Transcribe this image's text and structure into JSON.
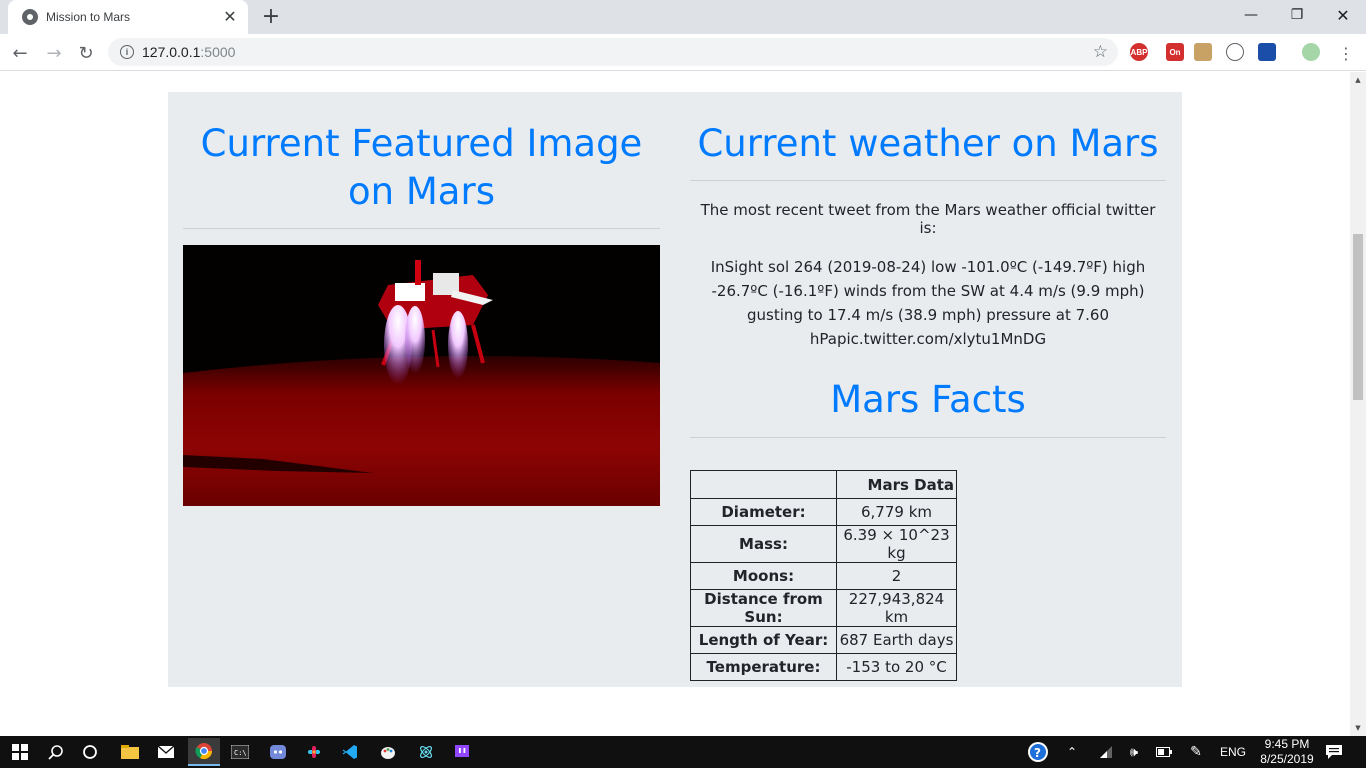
{
  "browser": {
    "tab_title": "Mission to Mars",
    "url_host": "127.0.0.1",
    "url_port": ":5000",
    "extensions": [
      "ABP",
      "On"
    ]
  },
  "left": {
    "title_line1": "Current Featured Image",
    "title_line2": "on Mars"
  },
  "weather": {
    "title": "Current weather on Mars",
    "intro": "The most recent tweet from the Mars weather official twitter is:",
    "tweet": "InSight sol 264 (2019-08-24) low -101.0ºC (-149.7ºF) high -26.7ºC (-16.1ºF) winds from the SW at 4.4 m/s (9.9 mph) gusting to 17.4 m/s (38.9 mph) pressure at 7.60 hPapic.twitter.com/xlytu1MnDG"
  },
  "facts": {
    "title": "Mars Facts",
    "header": "Mars Data",
    "rows": [
      {
        "label": "Diameter:",
        "value": "6,779 km"
      },
      {
        "label": "Mass:",
        "value": "6.39 × 10^23 kg"
      },
      {
        "label": "Moons:",
        "value": "2"
      },
      {
        "label": "Distance from Sun:",
        "value": "227,943,824 km"
      },
      {
        "label": "Length of Year:",
        "value": "687 Earth days"
      },
      {
        "label": "Temperature:",
        "value": "-153 to 20 °C"
      }
    ]
  },
  "taskbar": {
    "lang": "ENG",
    "time": "9:45 PM",
    "date": "8/25/2019"
  }
}
